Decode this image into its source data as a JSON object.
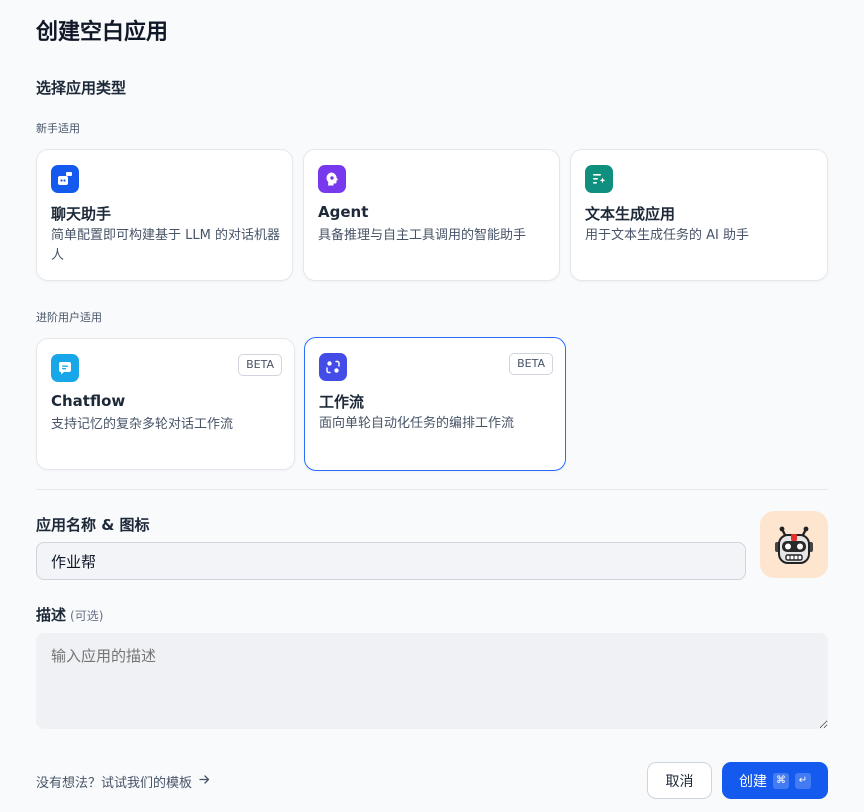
{
  "dialog": {
    "title": "创建空白应用"
  },
  "app_type": {
    "section_title": "选择应用类型",
    "beginner_label": "新手适用",
    "advanced_label": "进阶用户适用",
    "cards": [
      {
        "title": "聊天助手",
        "desc": "简单配置即可构建基于 LLM 的对话机器人",
        "icon": "chat-bot-icon",
        "color": "#155aef"
      },
      {
        "title": "Agent",
        "desc": "具备推理与自主工具调用的智能助手",
        "icon": "agent-icon",
        "color": "#7839ee"
      },
      {
        "title": "文本生成应用",
        "desc": "用于文本生成任务的 AI 助手",
        "icon": "text-generation-icon",
        "color": "#0f8f7e"
      },
      {
        "title": "Chatflow",
        "desc": "支持记忆的复杂多轮对话工作流",
        "icon": "chatflow-icon",
        "color": "#17a7e8",
        "badge": "BETA"
      },
      {
        "title": "工作流",
        "desc": "面向单轮自动化任务的编排工作流",
        "icon": "workflow-icon",
        "color": "#444ce7",
        "badge": "BETA",
        "selected": true
      }
    ]
  },
  "name_field": {
    "label": "应用名称 & 图标",
    "value": "作业帮",
    "app_icon": "robot-emoji-icon"
  },
  "desc_field": {
    "label": "描述",
    "optional": "(可选)",
    "placeholder": "输入应用的描述"
  },
  "footer": {
    "hint": "没有想法？试试我们的模板",
    "cancel": "取消",
    "create": "创建",
    "shortcut_cmd": "⌘",
    "shortcut_enter": "↵"
  }
}
